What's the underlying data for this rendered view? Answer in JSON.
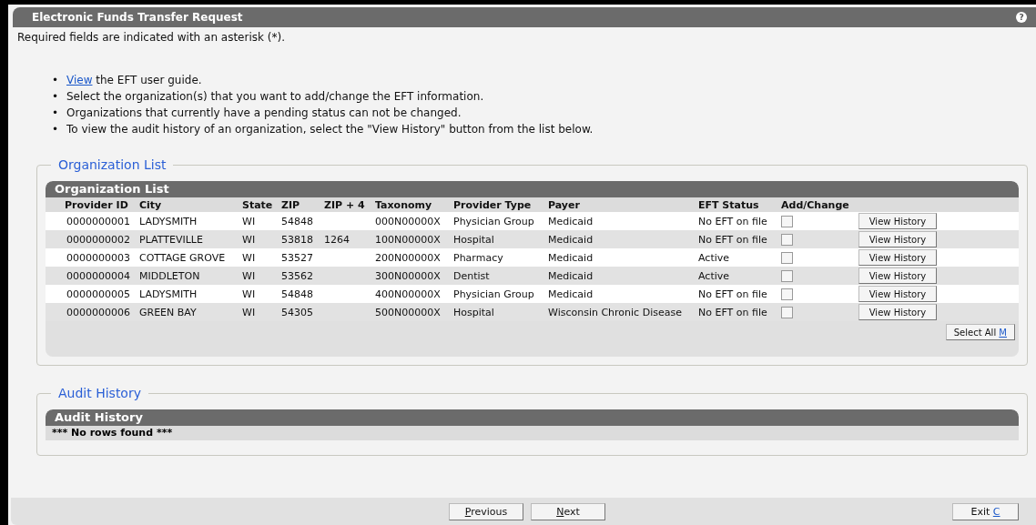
{
  "window": {
    "title": "Electronic Funds Transfer Request",
    "help": "?"
  },
  "required_note": "Required fields are indicated with an asterisk (*).",
  "instructions": [
    {
      "marker": "•",
      "link": "View",
      "text": "the EFT user guide."
    },
    {
      "marker": "•",
      "text": "Select the organization(s) that you want to add/change the EFT information."
    },
    {
      "marker": "•",
      "text": "Organizations that currently have a pending status can not be changed."
    },
    {
      "marker": "•",
      "text": "To view the audit history of an organization, select the \"View History\" button from the list below."
    }
  ],
  "organization_section": {
    "legend": "Organization List",
    "title": "Organization List",
    "columns": [
      "Provider ID",
      "City",
      "State",
      "ZIP",
      "ZIP + 4",
      "Taxonomy",
      "Provider Type",
      "Payer",
      "EFT Status",
      "Add/Change"
    ],
    "rows": [
      {
        "provider_id": "0000000001",
        "city": "LADYSMITH",
        "state": "WI",
        "zip": "54848",
        "taxonomy": "000N00000X",
        "provider_type": "Physician Group",
        "payer": "Medicaid",
        "eft_status": "No EFT on file",
        "checked": false,
        "button": "View History"
      },
      {
        "provider_id": "0000000002",
        "city": "PLATTEVILLE",
        "state": "WI",
        "zip": "53818",
        "zip4": "1264",
        "taxonomy": "100N00000X",
        "provider_type": "Hospital",
        "payer": "Medicaid",
        "eft_status": "No EFT on file",
        "checked": false,
        "button": "View History"
      },
      {
        "provider_id": "0000000003",
        "city": "COTTAGE GROVE",
        "state": "WI",
        "zip": "53527",
        "taxonomy": "200N00000X",
        "provider_type": "Pharmacy",
        "payer": "Medicaid",
        "eft_status": "Active",
        "checked": false,
        "button": "View History"
      },
      {
        "provider_id": "0000000004",
        "city": "MIDDLETON",
        "state": "WI",
        "zip": "53562",
        "taxonomy": "300N00000X",
        "provider_type": "Dentist",
        "payer": "Medicaid",
        "eft_status": "Active",
        "checked": false,
        "button": "View History"
      },
      {
        "provider_id": "0000000005",
        "city": "LADYSMITH",
        "state": "WI",
        "zip": "54848",
        "taxonomy": "400N00000X",
        "provider_type": "Physician Group",
        "payer": "Medicaid",
        "eft_status": "No EFT on file",
        "checked": false,
        "button": "View History"
      },
      {
        "provider_id": "0000000006",
        "city": "GREEN BAY",
        "state": "WI",
        "zip": "54305",
        "taxonomy": "500N00000X",
        "provider_type": "Hospital",
        "payer": "Wisconsin Chronic Disease",
        "eft_status": "No EFT on file",
        "checked": false,
        "button": "View History"
      }
    ],
    "select_all": {
      "kind": "key_last",
      "label": "Select All",
      "key": "M"
    }
  },
  "audit_section": {
    "legend": "Audit History",
    "title": "Audit History",
    "empty_message": "*** No rows found ***"
  },
  "footer_buttons": [
    {
      "kind": "key_first",
      "key": "P",
      "label": "revious"
    },
    {
      "kind": "key_first",
      "key": "N",
      "label": "ext"
    },
    {
      "kind": "key_last",
      "label": "Exit",
      "key": "C"
    }
  ]
}
